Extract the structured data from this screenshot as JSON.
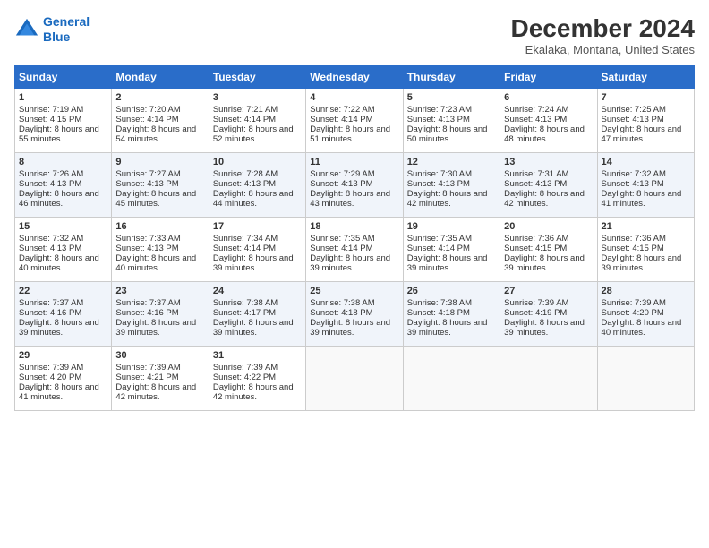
{
  "logo": {
    "line1": "General",
    "line2": "Blue"
  },
  "title": "December 2024",
  "subtitle": "Ekalaka, Montana, United States",
  "days_header": [
    "Sunday",
    "Monday",
    "Tuesday",
    "Wednesday",
    "Thursday",
    "Friday",
    "Saturday"
  ],
  "weeks": [
    [
      {
        "day": "1",
        "sunrise": "Sunrise: 7:19 AM",
        "sunset": "Sunset: 4:15 PM",
        "daylight": "Daylight: 8 hours and 55 minutes."
      },
      {
        "day": "2",
        "sunrise": "Sunrise: 7:20 AM",
        "sunset": "Sunset: 4:14 PM",
        "daylight": "Daylight: 8 hours and 54 minutes."
      },
      {
        "day": "3",
        "sunrise": "Sunrise: 7:21 AM",
        "sunset": "Sunset: 4:14 PM",
        "daylight": "Daylight: 8 hours and 52 minutes."
      },
      {
        "day": "4",
        "sunrise": "Sunrise: 7:22 AM",
        "sunset": "Sunset: 4:14 PM",
        "daylight": "Daylight: 8 hours and 51 minutes."
      },
      {
        "day": "5",
        "sunrise": "Sunrise: 7:23 AM",
        "sunset": "Sunset: 4:13 PM",
        "daylight": "Daylight: 8 hours and 50 minutes."
      },
      {
        "day": "6",
        "sunrise": "Sunrise: 7:24 AM",
        "sunset": "Sunset: 4:13 PM",
        "daylight": "Daylight: 8 hours and 48 minutes."
      },
      {
        "day": "7",
        "sunrise": "Sunrise: 7:25 AM",
        "sunset": "Sunset: 4:13 PM",
        "daylight": "Daylight: 8 hours and 47 minutes."
      }
    ],
    [
      {
        "day": "8",
        "sunrise": "Sunrise: 7:26 AM",
        "sunset": "Sunset: 4:13 PM",
        "daylight": "Daylight: 8 hours and 46 minutes."
      },
      {
        "day": "9",
        "sunrise": "Sunrise: 7:27 AM",
        "sunset": "Sunset: 4:13 PM",
        "daylight": "Daylight: 8 hours and 45 minutes."
      },
      {
        "day": "10",
        "sunrise": "Sunrise: 7:28 AM",
        "sunset": "Sunset: 4:13 PM",
        "daylight": "Daylight: 8 hours and 44 minutes."
      },
      {
        "day": "11",
        "sunrise": "Sunrise: 7:29 AM",
        "sunset": "Sunset: 4:13 PM",
        "daylight": "Daylight: 8 hours and 43 minutes."
      },
      {
        "day": "12",
        "sunrise": "Sunrise: 7:30 AM",
        "sunset": "Sunset: 4:13 PM",
        "daylight": "Daylight: 8 hours and 42 minutes."
      },
      {
        "day": "13",
        "sunrise": "Sunrise: 7:31 AM",
        "sunset": "Sunset: 4:13 PM",
        "daylight": "Daylight: 8 hours and 42 minutes."
      },
      {
        "day": "14",
        "sunrise": "Sunrise: 7:32 AM",
        "sunset": "Sunset: 4:13 PM",
        "daylight": "Daylight: 8 hours and 41 minutes."
      }
    ],
    [
      {
        "day": "15",
        "sunrise": "Sunrise: 7:32 AM",
        "sunset": "Sunset: 4:13 PM",
        "daylight": "Daylight: 8 hours and 40 minutes."
      },
      {
        "day": "16",
        "sunrise": "Sunrise: 7:33 AM",
        "sunset": "Sunset: 4:13 PM",
        "daylight": "Daylight: 8 hours and 40 minutes."
      },
      {
        "day": "17",
        "sunrise": "Sunrise: 7:34 AM",
        "sunset": "Sunset: 4:14 PM",
        "daylight": "Daylight: 8 hours and 39 minutes."
      },
      {
        "day": "18",
        "sunrise": "Sunrise: 7:35 AM",
        "sunset": "Sunset: 4:14 PM",
        "daylight": "Daylight: 8 hours and 39 minutes."
      },
      {
        "day": "19",
        "sunrise": "Sunrise: 7:35 AM",
        "sunset": "Sunset: 4:14 PM",
        "daylight": "Daylight: 8 hours and 39 minutes."
      },
      {
        "day": "20",
        "sunrise": "Sunrise: 7:36 AM",
        "sunset": "Sunset: 4:15 PM",
        "daylight": "Daylight: 8 hours and 39 minutes."
      },
      {
        "day": "21",
        "sunrise": "Sunrise: 7:36 AM",
        "sunset": "Sunset: 4:15 PM",
        "daylight": "Daylight: 8 hours and 39 minutes."
      }
    ],
    [
      {
        "day": "22",
        "sunrise": "Sunrise: 7:37 AM",
        "sunset": "Sunset: 4:16 PM",
        "daylight": "Daylight: 8 hours and 39 minutes."
      },
      {
        "day": "23",
        "sunrise": "Sunrise: 7:37 AM",
        "sunset": "Sunset: 4:16 PM",
        "daylight": "Daylight: 8 hours and 39 minutes."
      },
      {
        "day": "24",
        "sunrise": "Sunrise: 7:38 AM",
        "sunset": "Sunset: 4:17 PM",
        "daylight": "Daylight: 8 hours and 39 minutes."
      },
      {
        "day": "25",
        "sunrise": "Sunrise: 7:38 AM",
        "sunset": "Sunset: 4:18 PM",
        "daylight": "Daylight: 8 hours and 39 minutes."
      },
      {
        "day": "26",
        "sunrise": "Sunrise: 7:38 AM",
        "sunset": "Sunset: 4:18 PM",
        "daylight": "Daylight: 8 hours and 39 minutes."
      },
      {
        "day": "27",
        "sunrise": "Sunrise: 7:39 AM",
        "sunset": "Sunset: 4:19 PM",
        "daylight": "Daylight: 8 hours and 39 minutes."
      },
      {
        "day": "28",
        "sunrise": "Sunrise: 7:39 AM",
        "sunset": "Sunset: 4:20 PM",
        "daylight": "Daylight: 8 hours and 40 minutes."
      }
    ],
    [
      {
        "day": "29",
        "sunrise": "Sunrise: 7:39 AM",
        "sunset": "Sunset: 4:20 PM",
        "daylight": "Daylight: 8 hours and 41 minutes."
      },
      {
        "day": "30",
        "sunrise": "Sunrise: 7:39 AM",
        "sunset": "Sunset: 4:21 PM",
        "daylight": "Daylight: 8 hours and 42 minutes."
      },
      {
        "day": "31",
        "sunrise": "Sunrise: 7:39 AM",
        "sunset": "Sunset: 4:22 PM",
        "daylight": "Daylight: 8 hours and 42 minutes."
      },
      null,
      null,
      null,
      null
    ]
  ]
}
